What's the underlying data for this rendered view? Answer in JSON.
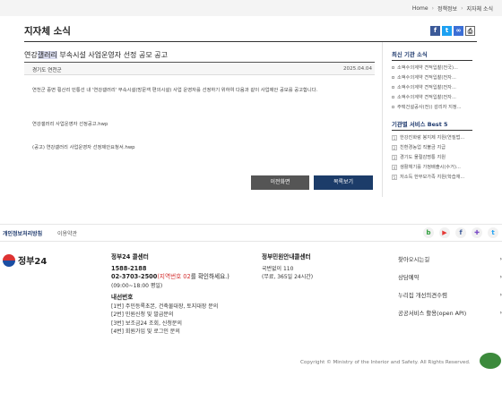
{
  "breadcrumb": [
    "Home",
    "정책정보",
    "지자체 소식"
  ],
  "page_title": "지자체 소식",
  "article": {
    "title_pre": "연강",
    "title_hl": "갤러리",
    "title_post": " 부속시설 사업운영자 선정 공모 공고",
    "source": "경기도 연천군",
    "date": "2025.04.04",
    "body": "연천군 중면 횡산리 민통선 내 '연강갤러리' 부속시설(방문객 편의시설) 사업 운영자를 선정하기 위하여 다음과 같이 사업제안 공모를 공고합니다.",
    "attachment1": "연강갤러리 사업운영자 선정공고.hwp",
    "attachment2": "(공고) 연강갤러리 사업운영자 선정제안요청서.hwp"
  },
  "buttons": {
    "prev": "이전화면",
    "list": "목록보기"
  },
  "sidebar": {
    "latest_title": "최신 기관 소식",
    "latest": [
      "소액수의계약 견적입찰(전국)...",
      "소액수의계약 견적입찰(전자...",
      "소액수의계약 견적입찰(전자...",
      "소액수의계약 견적입찰(전자...",
      "주택건설공사(전)) 감리자 지정..."
    ],
    "best_title": "기관별 서비스 Best 5",
    "best": [
      "한강진화랑 봉지제 지원(연질법...",
      "친환경농업 직불금 지급",
      "경기도 물절감명통 지원",
      "생활체기를 가정배출시(수거)...",
      "저소득 한부모가족 지원(학습재..."
    ]
  },
  "footer": {
    "privacy": "개인정보처리방침",
    "terms": "이용약관",
    "logo": "정부24",
    "callcenter_title": "정부24 콜센터",
    "phone1": "1588-2188",
    "phone2_pre": "02-3703-2500",
    "phone2_red": "(지역번호 02",
    "phone2_post": "를 확인하세요.)",
    "hours": "(09:00~18:00 평일)",
    "ext_title": "내선번호",
    "ext": [
      "[1번] 주민등록초본, 건축물대장, 토지대장 문의",
      "[2번] 민원신청 및 발급문의",
      "[3번] 보조금24 조회, 신청문의",
      "[4번] 회원가입 및 로그인 문의"
    ],
    "center_title": "정부민원안내콜센터",
    "center_phone": "국번없이 110",
    "center_hours": "(무료, 365일 24시간)",
    "menu": [
      "찾아오시는길",
      "상담예약",
      "누리집 개선의견수렴",
      "공공서비스 활용(open API)"
    ],
    "copyright": "Copyright © Ministry of the Interior and Safety. All Rights Reserved.",
    "mark": "Web 접근성"
  },
  "colors": {
    "list_button": "#1c3c69",
    "sidebar_title": "#1f3a6e",
    "red": "#d32f2f"
  }
}
